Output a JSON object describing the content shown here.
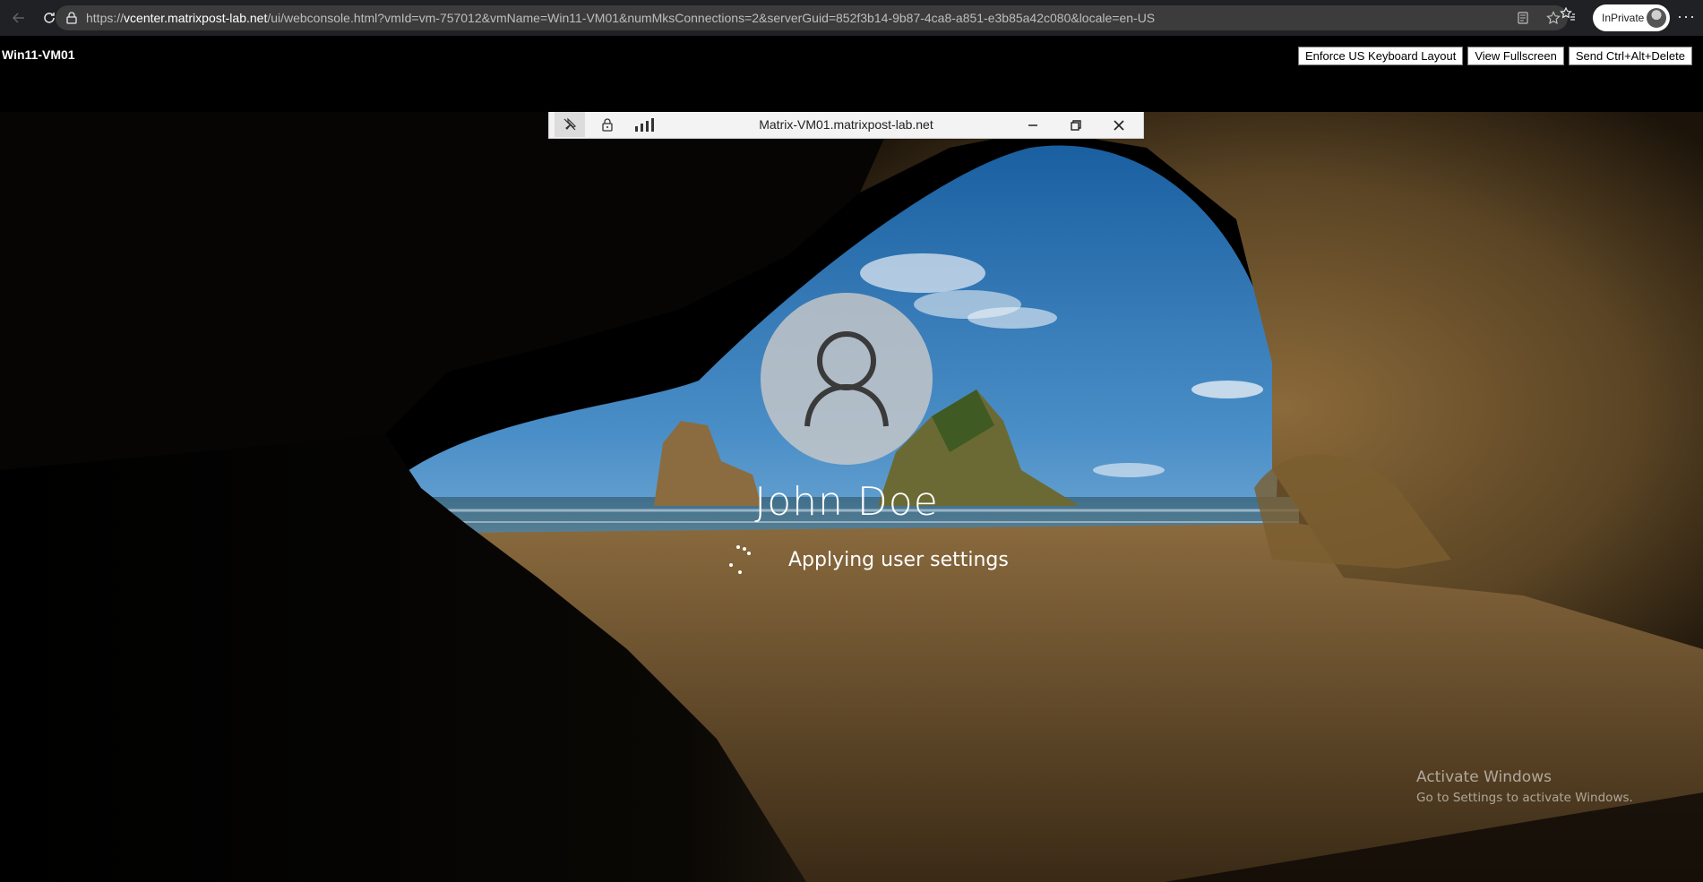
{
  "browser": {
    "url_prefix": "https://",
    "url_host": "vcenter.matrixpost-lab.net",
    "url_path": "/ui/webconsole.html?vmId=vm-757012&vmName=Win11-VM01&numMksConnections=2&serverGuid=852f3b14-9b87-4ca8-a851-e3b85a42c080&locale=en-US",
    "profile_label": "InPrivate",
    "more_label": "···",
    "icons": [
      "back-arrow-icon",
      "refresh-icon",
      "site-info-icon",
      "reading-view-icon",
      "favorite-star-icon",
      "favorites-list-icon",
      "more-icon"
    ]
  },
  "console": {
    "vm_name": "Win11-VM01",
    "buttons": {
      "keyboard": "Enforce US Keyboard Layout",
      "fullscreen": "View Fullscreen",
      "cad": "Send Ctrl+Alt+Delete"
    }
  },
  "connection_bar": {
    "title": "Matrix-VM01.matrixpost-lab.net",
    "icons": [
      "pin-icon",
      "lock-icon",
      "signal-icon",
      "minimize-icon",
      "restore-icon",
      "close-icon"
    ]
  },
  "lock_screen": {
    "user_name": "John Doe",
    "status": "Applying user settings",
    "activate_title": "Activate Windows",
    "activate_sub": "Go to Settings to activate Windows."
  },
  "colors": {
    "browser_chrome": "#202124",
    "address_bar": "#3c3c3c",
    "console_bg": "#000000",
    "conn_bar": "#f3f3f3"
  }
}
